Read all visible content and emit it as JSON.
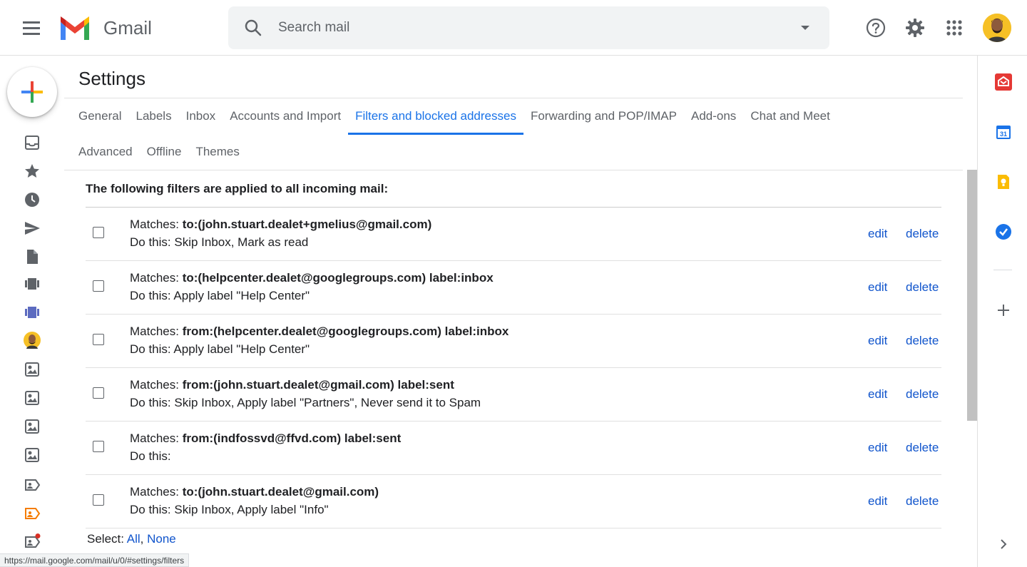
{
  "header": {
    "app_name": "Gmail",
    "search_placeholder": "Search mail"
  },
  "settings": {
    "title": "Settings",
    "tabs_row1": [
      "General",
      "Labels",
      "Inbox",
      "Accounts and Import",
      "Filters and blocked addresses",
      "Forwarding and POP/IMAP",
      "Add-ons",
      "Chat and Meet"
    ],
    "tabs_row2": [
      "Advanced",
      "Offline",
      "Themes"
    ],
    "active_tab": "Filters and blocked addresses"
  },
  "filters": {
    "heading": "The following filters are applied to all incoming mail:",
    "matches_prefix": "Matches: ",
    "edit_label": "edit",
    "delete_label": "delete",
    "items": [
      {
        "criteria": "to:(john.stuart.dealet+gmelius@gmail.com)",
        "action": "Do this: Skip Inbox, Mark as read"
      },
      {
        "criteria": "to:(helpcenter.dealet@googlegroups.com) label:inbox",
        "action": "Do this: Apply label \"Help Center\""
      },
      {
        "criteria": "from:(helpcenter.dealet@googlegroups.com) label:inbox",
        "action": "Do this: Apply label \"Help Center\""
      },
      {
        "criteria": "from:(john.stuart.dealet@gmail.com) label:sent",
        "action": "Do this: Skip Inbox, Apply label \"Partners\", Never send it to Spam"
      },
      {
        "criteria": "from:(indfossvd@ffvd.com) label:sent",
        "action": "Do this:"
      },
      {
        "criteria": "to:(john.stuart.dealet@gmail.com)",
        "action": "Do this: Skip Inbox, Apply label \"Info\""
      }
    ]
  },
  "select": {
    "prefix": "Select: ",
    "all": "All",
    "separator": ", ",
    "none": "None"
  },
  "status_url": "https://mail.google.com/mail/u/0/#settings/filters",
  "colors": {
    "accent": "#1a73e8",
    "link": "#1155cc"
  }
}
